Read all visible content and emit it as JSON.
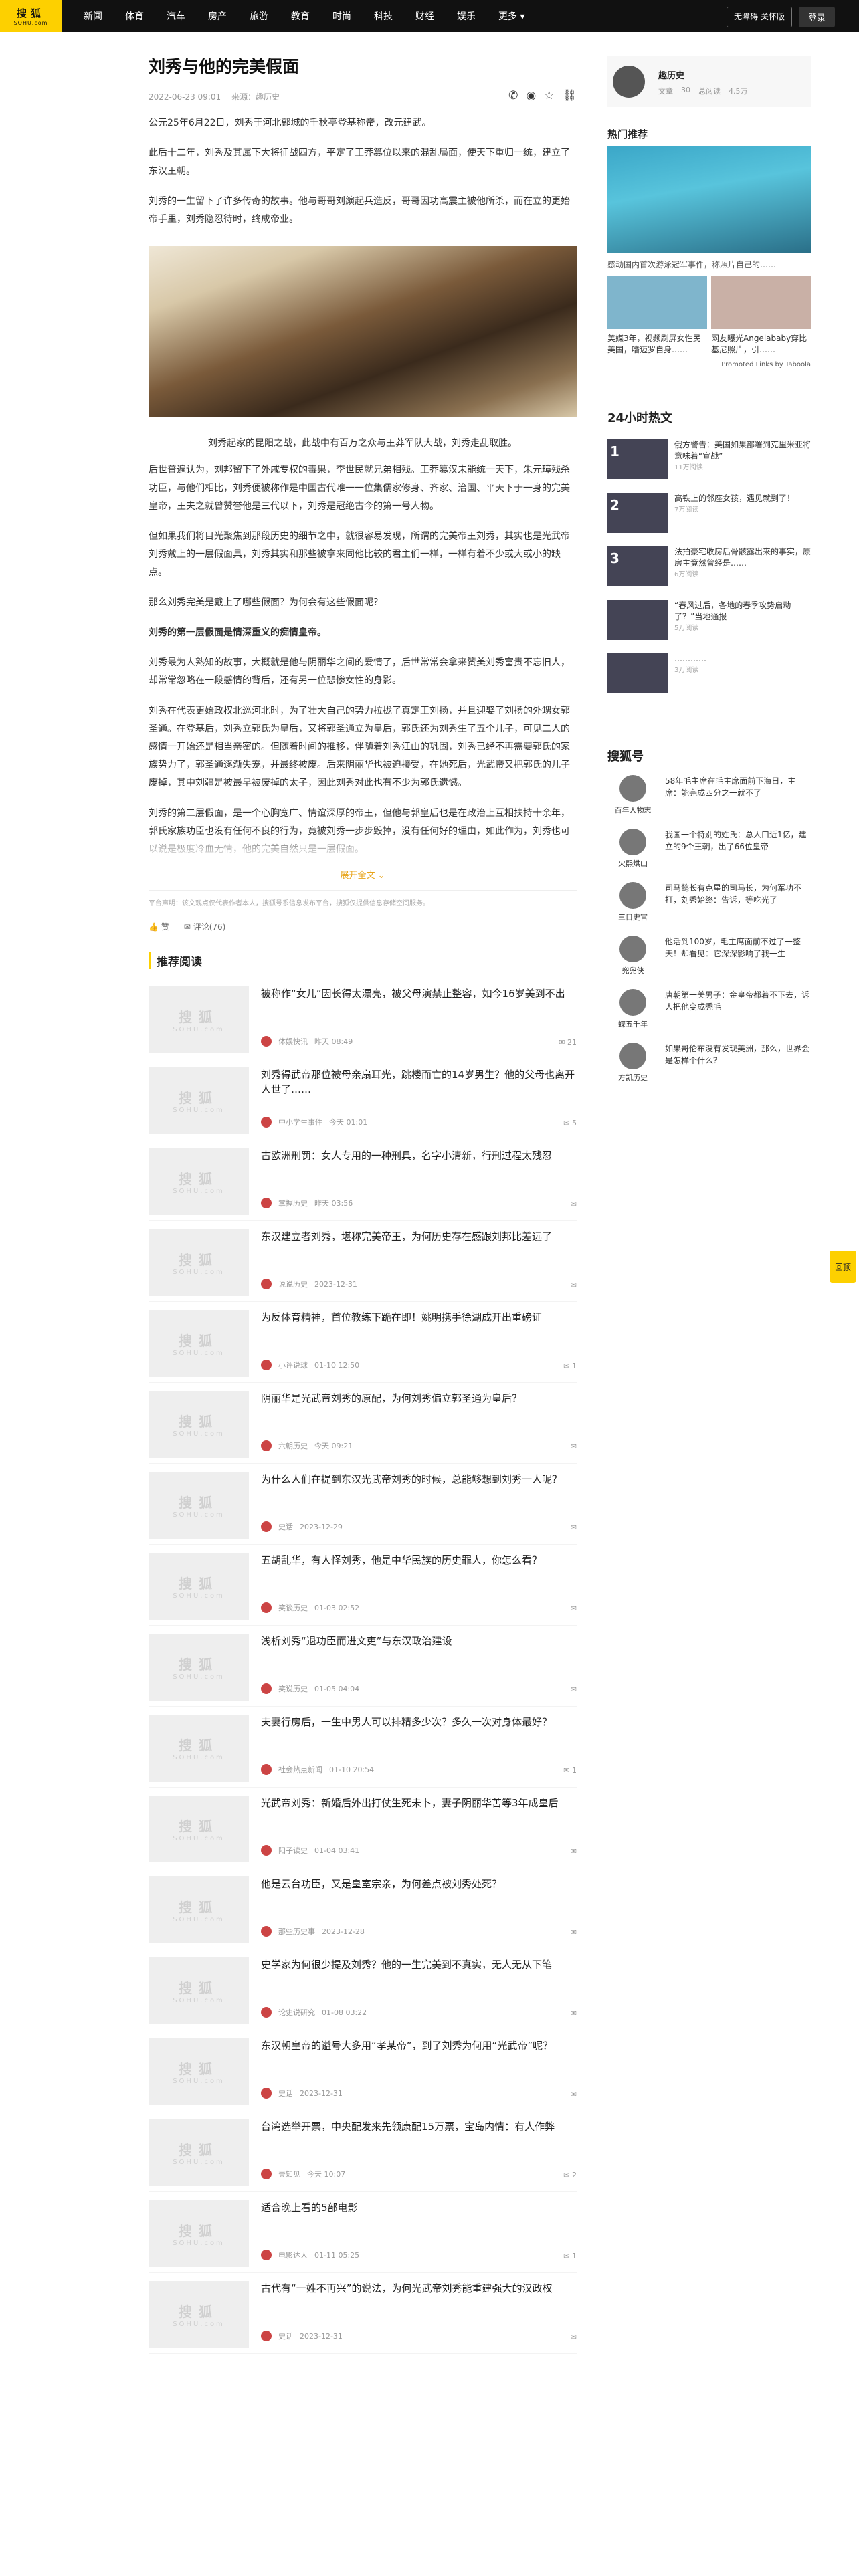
{
  "nav": {
    "logo_top": "搜狐",
    "logo_bottom": "SOHU.com",
    "items": [
      "新闻",
      "体育",
      "汽车",
      "房产",
      "旅游",
      "教育",
      "时尚",
      "科技",
      "财经",
      "娱乐",
      "更多"
    ],
    "barrier_free": "无障碍 关怀版",
    "login": "登录"
  },
  "article": {
    "title": "刘秀与他的完美假面",
    "date": "2022-06-23 09:01",
    "source": "来源：",
    "author": "趣历史",
    "paragraphs": [
      "公元25年6月22日，刘秀于河北鄗城的千秋亭登基称帝，改元建武。",
      "此后十二年，刘秀及其属下大将征战四方，平定了王莽篡位以来的混乱局面，使天下重归一统，建立了东汉王朝。",
      "刘秀的一生留下了许多传奇的故事。他与哥哥刘縯起兵造反，哥哥因功高震主被他所杀，而在立的更始帝手里，刘秀隐忍待时，终成帝业。"
    ],
    "image_caption": "刘秀起家的昆阳之战，此战中有百万之众与王莽军队大战，刘秀走乱取胜。",
    "paragraphs2": [
      "后世普遍认为，刘邦留下了外戚专权的毒果，李世民就兄弟相残。王莽篡汉未能统一天下，朱元璋残杀功臣，与他们相比，刘秀便被称作是中国古代唯一一位集儒家修身、齐家、治国、平天下于一身的完美皇帝，王夫之就曾赞誉他是三代以下，刘秀是冠绝古今的第一号人物。",
      "但如果我们将目光聚焦到那段历史的细节之中，就很容易发现，所谓的完美帝王刘秀，其实也是光武帝刘秀戴上的一层假面具，刘秀其实和那些被拿来同他比较的君主们一样，一样有着不少或大或小的缺点。",
      "那么刘秀完美是戴上了哪些假面？为何会有这些假面呢？"
    ],
    "bold_para": "刘秀的第一层假面是情深重义的痴情皇帝。",
    "paragraphs3": [
      "刘秀最为人熟知的故事，大概就是他与阴丽华之间的爱情了，后世常常会拿来赞美刘秀富贵不忘旧人，却常常忽略在一段感情的背后，还有另一位悲惨女性的身影。",
      "刘秀在代表更始政权北巡河北时，为了壮大自己的势力拉拢了真定王刘扬，并且迎娶了刘扬的外甥女郭圣通。在登基后，刘秀立郭氏为皇后，又将郭圣通立为皇后，郭氏还为刘秀生了五个儿子，可见二人的感情一开始还是相当亲密的。但随着时间的推移，伴随着刘秀江山的巩固，刘秀已经不再需要郭氏的家族势力了，郭圣通逐渐失宠，并最终被废。后来阴丽华也被迫接受，在她死后，光武帝又把郭氏的儿子废掉，其中刘疆是被最早被废掉的太子，因此刘秀对此也有不少为郭氏遗憾。",
      "刘秀的第二层假面，是一个心胸宽广、情谊深厚的帝王，但他与郭皇后也是在政治上互相扶持十余年，郭氏家族功臣也没有任何不良的行为，竟被刘秀一步步毁掉，没有任何好的理由，如此作为，刘秀也可以说是极度冷血无情，他的完美自然只是一层假面。"
    ],
    "expand": "展开全文",
    "disclaimer": "平台声明：该文观点仅代表作者本人，搜狐号系信息发布平台，搜狐仅提供信息存储空间服务。",
    "like_label": "赞",
    "comment_label": "评论",
    "comment_count": "(76)"
  },
  "recommend": {
    "title": "推荐阅读",
    "thumb_top": "搜狐",
    "thumb_bottom": "SOHU.com",
    "items": [
      {
        "headline": "被称作“女儿”因长得太漂亮，被父母演禁止整容，如今16岁美到不出",
        "author": "体娱快讯",
        "time": "昨天 08:49",
        "count": "21"
      },
      {
        "headline": "刘秀得武帝那位被母亲扇耳光，跳楼而亡的14岁男生？他的父母也离开人世了……",
        "author": "中小学生事件",
        "time": "今天 01:01",
        "count": "5"
      },
      {
        "headline": "古欧洲刑罚：女人专用的一种刑具，名字小清新，行刑过程太残忍",
        "author": "掌握历史",
        "time": "昨天 03:56",
        "count": ""
      },
      {
        "headline": "东汉建立者刘秀，堪称完美帝王，为何历史存在感跟刘邦比差远了",
        "author": "说说历史",
        "time": "2023-12-31",
        "count": ""
      },
      {
        "headline": "为反体育精神，首位教练下跪在即！姚明携手徐湖成开出重磅证",
        "author": "小评说球",
        "time": "01-10 12:50",
        "count": "1"
      },
      {
        "headline": "阴丽华是光武帝刘秀的原配，为何刘秀偏立郭圣通为皇后？",
        "author": "六朝历史",
        "time": "今天 09:21",
        "count": ""
      },
      {
        "headline": "为什么人们在提到东汉光武帝刘秀的时候，总能够想到刘秀一人呢？",
        "author": "史话",
        "time": "2023-12-29",
        "count": ""
      },
      {
        "headline": "五胡乱华，有人怪刘秀，他是中华民族的历史罪人，你怎么看？",
        "author": "笑谈历史",
        "time": "01-03 02:52",
        "count": ""
      },
      {
        "headline": "浅析刘秀“退功臣而进文吏”与东汉政治建设",
        "author": "笑说历史",
        "time": "01-05 04:04",
        "count": ""
      },
      {
        "headline": "夫妻行房后，一生中男人可以排精多少次？多久一次对身体最好？",
        "author": "社会热点新闻",
        "time": "01-10 20:54",
        "count": "1"
      },
      {
        "headline": "光武帝刘秀：新婚后外出打仗生死未卜，妻子阴丽华苦等3年成皇后",
        "author": "阳子读史",
        "time": "01-04 03:41",
        "count": ""
      },
      {
        "headline": "他是云台功臣，又是皇室宗亲，为何差点被刘秀处死？",
        "author": "那些历史事",
        "time": "2023-12-28",
        "count": ""
      },
      {
        "headline": "史学家为何很少提及刘秀？他的一生完美到不真实，无人无从下笔",
        "author": "论史说研究",
        "time": "01-08 03:22",
        "count": ""
      },
      {
        "headline": "东汉朝皇帝的谥号大多用“孝某帝”，到了刘秀为何用“光武帝”呢？",
        "author": "史话",
        "time": "2023-12-31",
        "count": ""
      },
      {
        "headline": "台湾选举开票，中央配发来先领康配15万票，宝岛内情：有人作弊",
        "author": "壹知见",
        "time": "今天 10:07",
        "count": "2"
      },
      {
        "headline": "适合晚上看的5部电影",
        "author": "电影达人",
        "time": "01-11 05:25",
        "count": "1"
      },
      {
        "headline": "古代有“一姓不再兴”的说法，为何光武帝刘秀能重建强大的汉政权",
        "author": "史话",
        "time": "2023-12-31",
        "count": ""
      }
    ]
  },
  "sidebar": {
    "author_name": "趣历史",
    "author_stats": [
      "文章",
      "30",
      "总阅读",
      "4.5万"
    ],
    "hot_title": "热门推荐",
    "hot_caption": "感动国内首次游泳冠军事件，称照片自己的……",
    "hot_small": [
      "美媒3年，视频刷屏女性民美国，嗜迈罗自身……",
      "网友曝光Angelababy穿比基尼照片，引……"
    ],
    "taboola": "Promoted Links by Taboola",
    "h24_title": "24小时热文",
    "h24": [
      {
        "num": "1",
        "text": "俄方警告：美国如果部署到克里米亚将意味着“宣战”",
        "sub": "11万阅读"
      },
      {
        "num": "2",
        "text": "高铁上的邻座女孩，遇见就到了！",
        "sub": "7万阅读"
      },
      {
        "num": "3",
        "text": "法拍豪宅收房后骨骸露出来的事实，原房主竟然曾经是……",
        "sub": "6万阅读"
      },
      {
        "num": "",
        "text": "“春风过后，各地的春季攻势启动了？”当地通报",
        "sub": "5万阅读"
      },
      {
        "num": "",
        "text": "…………",
        "sub": "3万阅读"
      }
    ],
    "shh_title": "搜狐号",
    "shh": [
      {
        "name": "百年人物志",
        "text": "58年毛主席在毛主席面前下海日，主席：能完成四分之一就不了"
      },
      {
        "name": "火熙烘山",
        "text": "我国一个特别的姓氏：总人口近1亿，建立的9个王朝，出了66位皇帝"
      },
      {
        "name": "三目史官",
        "text": "司马懿长有克星的司马长，为何军功不打，刘秀始终：告诉，等吃光了"
      },
      {
        "name": "兜兜侠",
        "text": "他活到100岁，毛主席面前不过了一整天！却看见：它深深影响了我一生"
      },
      {
        "name": "蝶五千年",
        "text": "唐朝第一美男子：金皇帝都着不下去，诉人把他变成秃毛"
      },
      {
        "name": "方凯历史",
        "text": "如果哥伦布没有发现美洲，那么，世界会是怎样个什么？"
      }
    ],
    "float": "回顶"
  }
}
